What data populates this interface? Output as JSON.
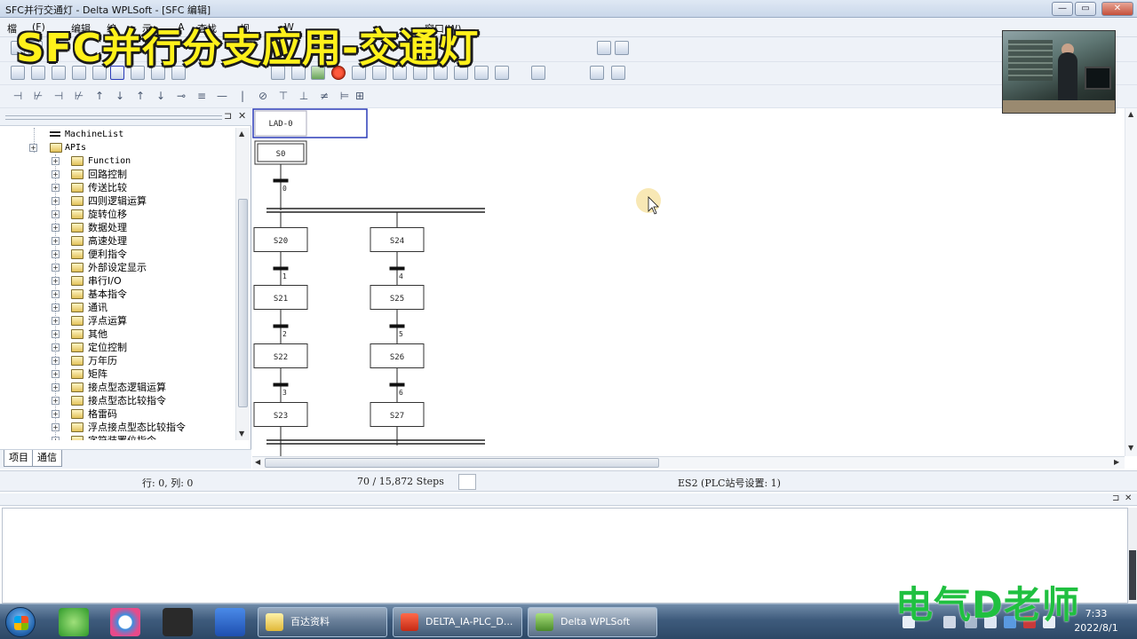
{
  "window": {
    "title": "SFC并行交通灯 - Delta WPLSoft - [SFC 编辑]",
    "min_btn": "—",
    "max_btn": "▭",
    "close_btn": "✕"
  },
  "menubar": {
    "items": [
      "檔",
      "(F)",
      "编辑",
      "编",
      "示",
      "A",
      "查找",
      "视",
      "W",
      "窗口(W)"
    ]
  },
  "overlay_title": "SFC并行分支应用-交通灯",
  "left_panel": {
    "pin": "⊐",
    "close": "✕",
    "tree": {
      "machine_list": "MachineList",
      "apis": "APIs",
      "folders": [
        "Function",
        "回路控制",
        "传送比较",
        "四则逻辑运算",
        "旋转位移",
        "数据处理",
        "高速处理",
        "便利指令",
        "外部设定显示",
        "串行I/O",
        "基本指令",
        "通讯",
        "浮点运算",
        "其他",
        "定位控制",
        "万年历",
        "矩阵",
        "接点型态逻辑运算",
        "接点型态比较指令",
        "格雷码",
        "浮点接点型态比较指令",
        "字符装置位指令"
      ]
    },
    "tabs": [
      "项目",
      "通信"
    ]
  },
  "sfc": {
    "ladder_block": "LAD-0",
    "init_step": "S0",
    "transition_0": "0",
    "branch_left": {
      "steps": [
        "S20",
        "S21",
        "S22",
        "S23"
      ],
      "transitions": [
        "1",
        "2",
        "3"
      ]
    },
    "branch_right": {
      "steps": [
        "S24",
        "S25",
        "S26",
        "S27"
      ],
      "transitions": [
        "4",
        "5",
        "6"
      ]
    }
  },
  "status": {
    "position": "行: 0, 列: 0",
    "steps": "70 / 15,872 Steps",
    "plc": "ES2 (PLC站号设置: 1)"
  },
  "output_panel": {
    "pin": "⊐",
    "close": "✕"
  },
  "watermark": "电气D老师",
  "taskbar": {
    "tasks": [
      "百达资料",
      "DELTA_IA-PLC_D...",
      "Delta WPLSoft"
    ],
    "clock_time": "7:33",
    "clock_date": "2022/8/1"
  },
  "colors": {
    "overlay_text": "#fff11a",
    "watermark": "#20c040",
    "selection_border": "#2b3cb8",
    "taskbar": "#3e5b7c"
  }
}
